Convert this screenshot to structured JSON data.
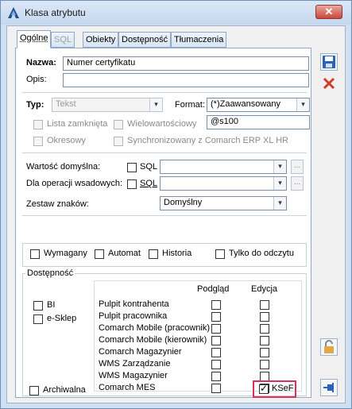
{
  "window": {
    "title": "Klasa atrybutu"
  },
  "tabs": [
    {
      "label": "Ogólne",
      "state": "active"
    },
    {
      "label": "SQL",
      "state": "disabled"
    },
    {
      "label": "Obiekty",
      "state": "normal"
    },
    {
      "label": "Dostępność",
      "state": "normal"
    },
    {
      "label": "Tłumaczenia",
      "state": "normal"
    }
  ],
  "form": {
    "nazwa_label": "Nazwa:",
    "nazwa_value": "Numer certyfikatu",
    "opis_label": "Opis:",
    "opis_value": "",
    "typ_label": "Typ:",
    "typ_value": "Tekst",
    "format_label": "Format:",
    "format_value": "(*)Zaawansowany",
    "format_code": "@s100",
    "lista_zamknieta": "Lista zamknięta",
    "wielowartosciowy": "Wielowartościowy",
    "okresowy": "Okresowy",
    "synchronizowany": "Synchronizowany z Comarch ERP XL HR",
    "wartosc_domyslna_label": "Wartość domyślna:",
    "dla_operacji_label": "Dla operacji wsadowych:",
    "sql_label": "SQL",
    "ellipsis": "...",
    "zestaw_znakow_label": "Zestaw znaków:",
    "zestaw_znakow_value": "Domyślny",
    "wymagany": "Wymagany",
    "automat": "Automat",
    "historia": "Historia",
    "tylko_do_odczytu": "Tylko do odczytu",
    "archiwalna": "Archiwalna",
    "ksef": "KSeF"
  },
  "dostepnosc": {
    "title": "Dostępność",
    "bi": "BI",
    "e_sklep": "e-Sklep",
    "col_podglad": "Podgląd",
    "col_edycja": "Edycja",
    "rows": [
      "Pulpit kontrahenta",
      "Pulpit pracownika",
      "Comarch Mobile (pracownik)",
      "Comarch Mobile (kierownik)",
      "Comarch Magazynier",
      "WMS Zarządzanie",
      "WMS Magazynier",
      "Comarch MES"
    ]
  },
  "checked": {
    "ksef": true
  },
  "colors": {
    "highlight": "#d9315c",
    "save_icon": "#2a62b8",
    "delete_icon": "#d23a2a"
  }
}
